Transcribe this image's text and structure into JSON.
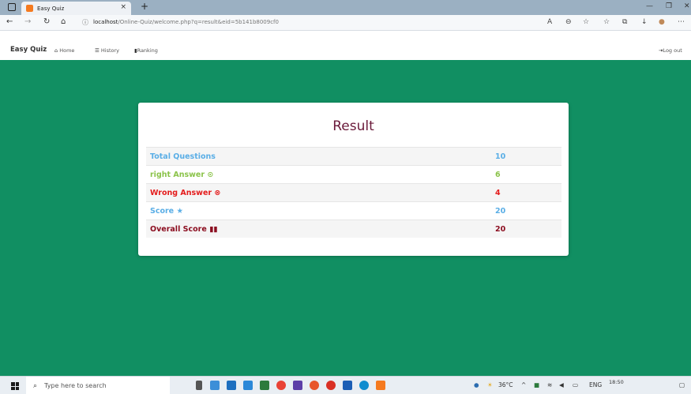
{
  "browser": {
    "tab_title": "Easy Quiz",
    "tab_close": "×",
    "new_tab": "+",
    "url_host": "localhost",
    "url_path": "/Online-Quiz/welcome.php?q=result&eid=5b141b8009cf0",
    "icons": [
      "back-icon",
      "forward-icon",
      "reload-icon",
      "home-icon",
      "info-icon",
      "read-aloud-icon",
      "zoom-icon",
      "favorite-icon",
      "favorites-icon",
      "collections-icon",
      "downloads-icon",
      "profile-icon",
      "more-icon"
    ]
  },
  "site": {
    "brand": "Easy Quiz",
    "nav": {
      "home": "Home",
      "history": "History",
      "ranking": "Ranking",
      "logout": "Log out"
    }
  },
  "result": {
    "title": "Result",
    "rows": [
      {
        "label": "Total Questions",
        "value": "10",
        "color": "#5aaee6",
        "icon": ""
      },
      {
        "label": "right Answer",
        "value": "6",
        "color": "#8bc34a",
        "icon": "check-circle-icon"
      },
      {
        "label": "Wrong Answer",
        "value": "4",
        "color": "#e41b1b",
        "icon": "x-circle-icon"
      },
      {
        "label": "Score",
        "value": "20",
        "color": "#5aaee6",
        "icon": "star-icon"
      },
      {
        "label": "Overall Score",
        "value": "20",
        "color": "#8b0d1f",
        "icon": "bar-chart-icon"
      }
    ]
  },
  "taskbar": {
    "search_placeholder": "Type here to search",
    "weather": "36°C",
    "language": "ENG",
    "time": "18:50"
  },
  "colors": {
    "page_bg": "#118f62",
    "title": "#6a1a3a"
  }
}
